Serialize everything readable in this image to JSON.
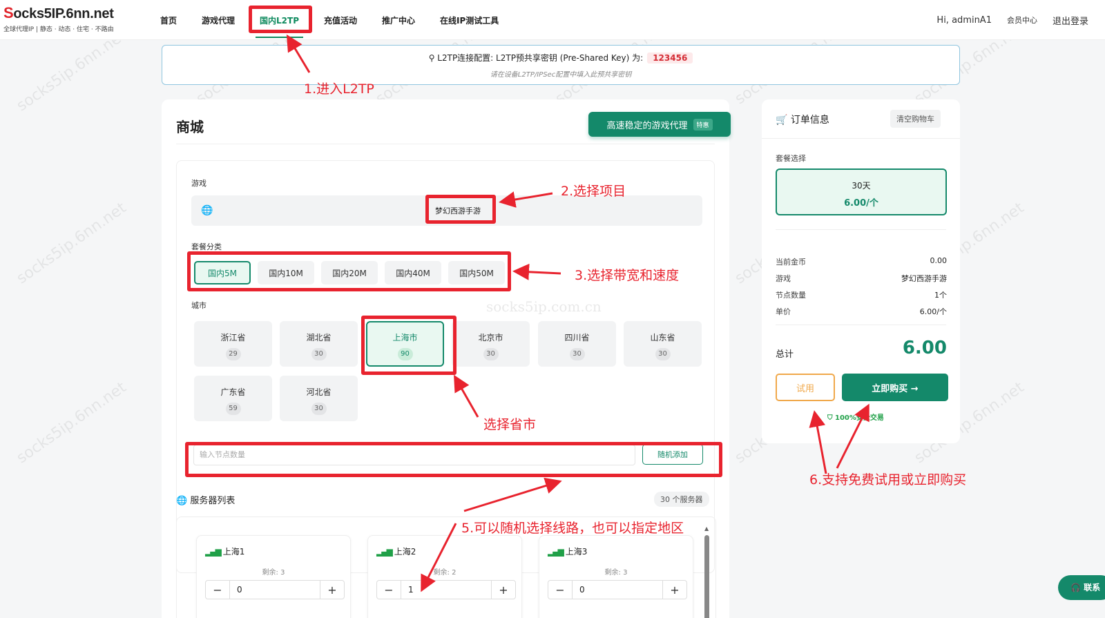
{
  "header": {
    "logo_prefix": "S",
    "logo_rest": "ocks5IP.6nn.net",
    "logo_sub": "全球代理IP | 静态 · 动态 · 住宅 · 不路由",
    "nav": [
      "首页",
      "游戏代理",
      "国内L2TP",
      "充值活动",
      "推广中心",
      "在线IP测试工具"
    ],
    "active_nav": "国内L2TP",
    "greeting": "Hi, adminA1",
    "member_center": "会员中心",
    "logout": "退出登录"
  },
  "notice": {
    "title": "L2TP连接配置: L2TP预共享密钥 (Pre-Shared Key) 为:",
    "key": "123456",
    "hint": "请在设备L2TP/IPSec配置中填入此预共享密钥"
  },
  "shop": {
    "title": "商城",
    "promo": "高速稳定的游戏代理",
    "promo_tag": "特惠",
    "game_label": "游戏",
    "game_value": "梦幻西游手游",
    "package_label": "套餐分类",
    "packages": [
      "国内5M",
      "国内10M",
      "国内20M",
      "国内40M",
      "国内50M"
    ],
    "city_label": "城市",
    "cities": [
      {
        "name": "浙江省",
        "count": "29"
      },
      {
        "name": "湖北省",
        "count": "30"
      },
      {
        "name": "上海市",
        "count": "90"
      },
      {
        "name": "北京市",
        "count": "30"
      },
      {
        "name": "四川省",
        "count": "30"
      },
      {
        "name": "山东省",
        "count": "30"
      },
      {
        "name": "广东省",
        "count": "59"
      },
      {
        "name": "河北省",
        "count": "30"
      }
    ],
    "qty_placeholder": "输入节点数量",
    "random_add": "随机添加",
    "server_list_title": "服务器列表",
    "server_count": "30 个服务器",
    "servers": [
      {
        "name": "上海1",
        "remaining": "剩余: 3",
        "qty": "0"
      },
      {
        "name": "上海2",
        "remaining": "剩余: 2",
        "qty": "1"
      },
      {
        "name": "上海3",
        "remaining": "剩余: 3",
        "qty": "0"
      }
    ]
  },
  "order": {
    "title": "订单信息",
    "clear": "清空购物车",
    "plan_label": "套餐选择",
    "plan_days": "30天",
    "plan_price": "6.00/个",
    "rows": [
      {
        "k": "当前金币",
        "v": "0.00"
      },
      {
        "k": "游戏",
        "v": "梦幻西游手游"
      },
      {
        "k": "节点数量",
        "v": "1个"
      },
      {
        "k": "单价",
        "v": "6.00/个"
      }
    ],
    "total_label": "总计",
    "total": "6.00",
    "trial": "试用",
    "buy": "立即购买 →",
    "secure": "100%安全交易"
  },
  "contact": "联系",
  "watermark_center": "socks5ip.com.cn",
  "watermark": "socks5ip.6nn.net",
  "annotations": {
    "a1": "1.进入L2TP",
    "a2": "2.选择项目",
    "a3": "3.选择带宽和速度",
    "a4": "选择省市",
    "a5": "5.可以随机选择线路，也可以指定地区",
    "a6": "6.支持免费试用或立即购买"
  },
  "colors": {
    "accent": "#14896a",
    "annotation": "#e8232e",
    "trial": "#f0a84a"
  }
}
